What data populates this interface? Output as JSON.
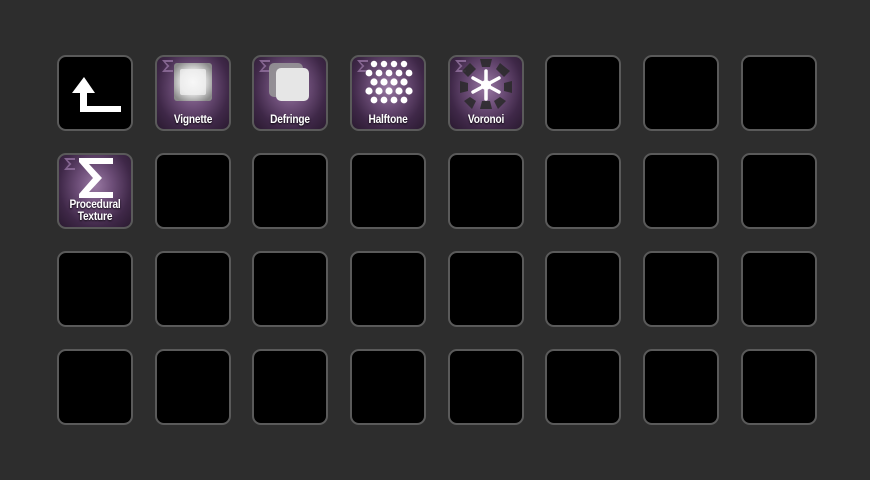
{
  "colors": {
    "background": "#2d2d2d",
    "key_border": "#5a5a5a",
    "key_empty": "#000000",
    "fx_purple": "#6c4d77",
    "label": "#ffffff"
  },
  "keys": [
    {
      "icon": "back-arrow-icon",
      "label": ""
    },
    {
      "icon": "vignette-icon",
      "label": "Vignette"
    },
    {
      "icon": "defringe-icon",
      "label": "Defringe"
    },
    {
      "icon": "halftone-icon",
      "label": "Halftone"
    },
    {
      "icon": "voronoi-icon",
      "label": "Voronoi"
    },
    {
      "icon": "",
      "label": ""
    },
    {
      "icon": "",
      "label": ""
    },
    {
      "icon": "",
      "label": ""
    },
    {
      "icon": "sigma-icon",
      "label_line1": "Procedural",
      "label_line2": "Texture"
    }
  ]
}
